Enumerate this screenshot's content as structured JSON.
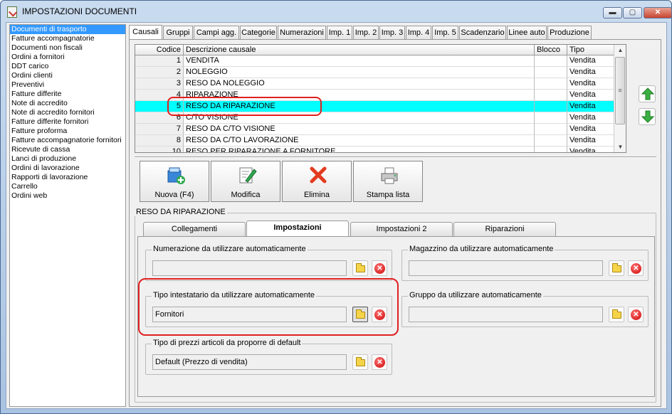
{
  "window": {
    "title": "IMPOSTAZIONI DOCUMENTI",
    "controls": {
      "minimize": "▬",
      "maximize": "▢",
      "close": "✕"
    }
  },
  "left_list": {
    "items": [
      {
        "label": "Documenti di trasporto",
        "selected": true
      },
      {
        "label": "Fatture accompagnatorie"
      },
      {
        "label": "Documenti non fiscali"
      },
      {
        "label": "Ordini a fornitori"
      },
      {
        "label": "DDT carico"
      },
      {
        "label": "Ordini clienti"
      },
      {
        "label": "Preventivi"
      },
      {
        "label": "Fatture differite"
      },
      {
        "label": "Note di accredito"
      },
      {
        "label": "Note di accredito fornitori"
      },
      {
        "label": "Fatture differite fornitori"
      },
      {
        "label": "Fatture proforma"
      },
      {
        "label": "Fatture accompagnatorie fornitori"
      },
      {
        "label": "Ricevute di cassa"
      },
      {
        "label": "Lanci di produzione"
      },
      {
        "label": "Ordini di lavorazione"
      },
      {
        "label": "Rapporti di lavorazione"
      },
      {
        "label": "Carrello"
      },
      {
        "label": "Ordini web"
      }
    ]
  },
  "tabs": [
    {
      "label": "Causali",
      "active": true
    },
    {
      "label": "Gruppi"
    },
    {
      "label": "Campi agg."
    },
    {
      "label": "Categorie"
    },
    {
      "label": "Numerazioni"
    },
    {
      "label": "Imp. 1"
    },
    {
      "label": "Imp. 2"
    },
    {
      "label": "Imp. 3"
    },
    {
      "label": "Imp. 4"
    },
    {
      "label": "Imp. 5"
    },
    {
      "label": "Scadenzario"
    },
    {
      "label": "Linee auto"
    },
    {
      "label": "Produzione"
    }
  ],
  "grid": {
    "columns": [
      "Codice",
      "Descrizione causale",
      "Blocco",
      "Tipo"
    ],
    "rows": [
      {
        "codice": "1",
        "descrizione": "VENDITA",
        "blocco": "",
        "tipo": "Vendita"
      },
      {
        "codice": "2",
        "descrizione": "NOLEGGIO",
        "blocco": "",
        "tipo": "Vendita"
      },
      {
        "codice": "3",
        "descrizione": "RESO DA NOLEGGIO",
        "blocco": "",
        "tipo": "Vendita"
      },
      {
        "codice": "4",
        "descrizione": "RIPARAZIONE",
        "blocco": "",
        "tipo": "Vendita"
      },
      {
        "codice": "5",
        "descrizione": "RESO DA RIPARAZIONE",
        "blocco": "",
        "tipo": "Vendita",
        "highlighted": true
      },
      {
        "codice": "6",
        "descrizione": "C/TO VISIONE",
        "blocco": "",
        "tipo": "Vendita"
      },
      {
        "codice": "7",
        "descrizione": "RESO DA C/TO VISIONE",
        "blocco": "",
        "tipo": "Vendita"
      },
      {
        "codice": "8",
        "descrizione": "RESO DA C/TO LAVORAZIONE",
        "blocco": "",
        "tipo": "Vendita"
      },
      {
        "codice": "10",
        "descrizione": "RESO PER RIPARAZIONE A FORNITORE",
        "blocco": "",
        "tipo": "Vendita"
      }
    ],
    "scroll": {
      "up": "▲",
      "down": "▼",
      "grip": "≡"
    }
  },
  "toolbar": {
    "new_label": "Nuova (F4)",
    "edit_label": "Modifica",
    "delete_label": "Elimina",
    "print_label": "Stampa lista"
  },
  "section": {
    "title": "RESO DA RIPARAZIONE",
    "subtabs": [
      {
        "label": "Collegamenti"
      },
      {
        "label": "Impostazioni",
        "active": true
      },
      {
        "label": "Impostazioni 2"
      },
      {
        "label": "Riparazioni"
      }
    ],
    "fields": {
      "numerazione": {
        "label": "Numerazione da utilizzare automaticamente",
        "value": ""
      },
      "magazzino": {
        "label": "Magazzino da utilizzare automaticamente",
        "value": ""
      },
      "tipo_intestatario": {
        "label": "Tipo intestatario da utilizzare automaticamente",
        "value": "Fornitori"
      },
      "gruppo": {
        "label": "Gruppo da utilizzare automaticamente",
        "value": ""
      },
      "tipo_prezzi": {
        "label": "Tipo di prezzi articoli da proporre di default",
        "value": "Default (Prezzo di vendita)"
      }
    },
    "clear_glyph": "✕"
  },
  "colors": {
    "highlight_row": "#00ffff",
    "selection": "#3399ff",
    "annotation": "#e02020"
  }
}
